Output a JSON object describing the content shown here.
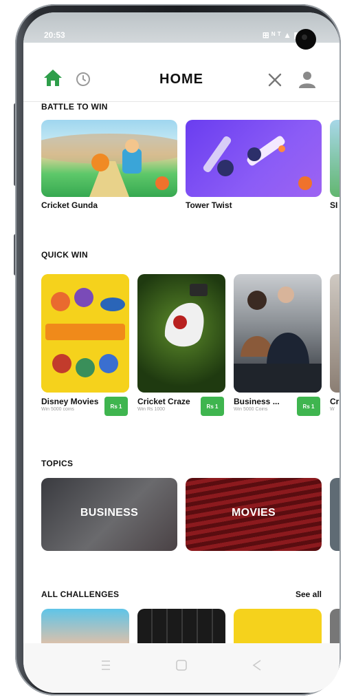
{
  "status": {
    "time": "20:53",
    "right": "⊞ ᴺ ᵀ ▲ ▮"
  },
  "header": {
    "title": "HOME"
  },
  "battle": {
    "title": "BATTLE TO WIN",
    "games": [
      {
        "name": "Cricket Gunda"
      },
      {
        "name": "Tower Twist"
      },
      {
        "name": "SI"
      }
    ]
  },
  "quickwin": {
    "title": "QUICK WIN",
    "items": [
      {
        "name": "Disney Movies",
        "sub": "Win 5000 coins",
        "price": "Rs 1"
      },
      {
        "name": "Cricket Craze",
        "sub": "Win Rs 1000",
        "price": "Rs 1"
      },
      {
        "name": "Business ...",
        "sub": "Win 5000 Coins",
        "price": "Rs 1"
      },
      {
        "name": "Cr",
        "sub": "W",
        "price": ""
      }
    ]
  },
  "topics": {
    "title": "TOPICS",
    "items": [
      {
        "label": "BUSINESS"
      },
      {
        "label": "MOVIES"
      }
    ]
  },
  "challenges": {
    "title": "ALL CHALLENGES",
    "see_all": "See all"
  },
  "colors": {
    "accent_green": "#3fb54f",
    "battle_1_bg": "#4fc06a",
    "battle_2_bg": "#7b4df0"
  }
}
